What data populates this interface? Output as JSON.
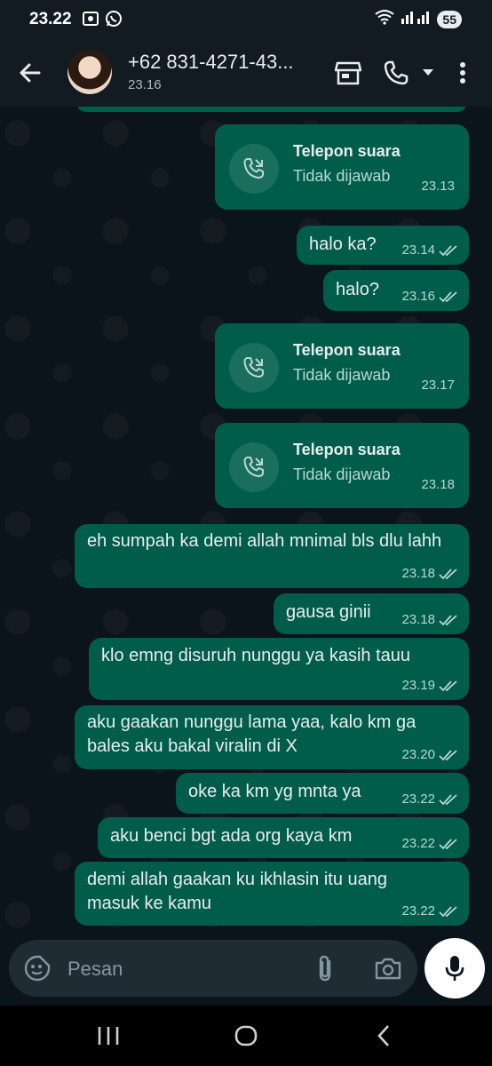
{
  "status_bar": {
    "time": "23.22",
    "battery": "55"
  },
  "header": {
    "contact_name": "+62 831-4271-43...",
    "last_seen": "23.16"
  },
  "messages": [
    {
      "kind": "call",
      "title": "Telepon suara",
      "subtitle": "Tidak dijawab",
      "time": "23.13"
    },
    {
      "kind": "text",
      "text": "halo ka?",
      "time": "23.14"
    },
    {
      "kind": "text",
      "text": "halo?",
      "time": "23.16"
    },
    {
      "kind": "call",
      "title": "Telepon suara",
      "subtitle": "Tidak dijawab",
      "time": "23.17"
    },
    {
      "kind": "call",
      "title": "Telepon suara",
      "subtitle": "Tidak dijawab",
      "time": "23.18"
    },
    {
      "kind": "text",
      "text": "eh sumpah ka demi allah mnimal bls dlu lahh",
      "time": "23.18"
    },
    {
      "kind": "text",
      "text": "gausa ginii",
      "time": "23.18"
    },
    {
      "kind": "text",
      "text": "klo emng disuruh nunggu ya kasih tauu",
      "time": "23.19"
    },
    {
      "kind": "text",
      "text": "aku gaakan nunggu lama yaa, kalo km ga bales aku bakal viralin di X",
      "time": "23.20"
    },
    {
      "kind": "text",
      "text": "oke ka km yg mnta ya",
      "time": "23.22"
    },
    {
      "kind": "text",
      "text": "aku benci bgt ada org kaya km",
      "time": "23.22"
    },
    {
      "kind": "text",
      "text": "demi allah gaakan ku ikhlasin itu uang masuk ke kamu",
      "time": "23.22"
    }
  ],
  "input": {
    "placeholder": "Pesan",
    "value": ""
  },
  "colors": {
    "bubble_out": "#005c4b",
    "background": "#0b141a",
    "bar": "#121b22",
    "input_bg": "#1f2c34"
  }
}
